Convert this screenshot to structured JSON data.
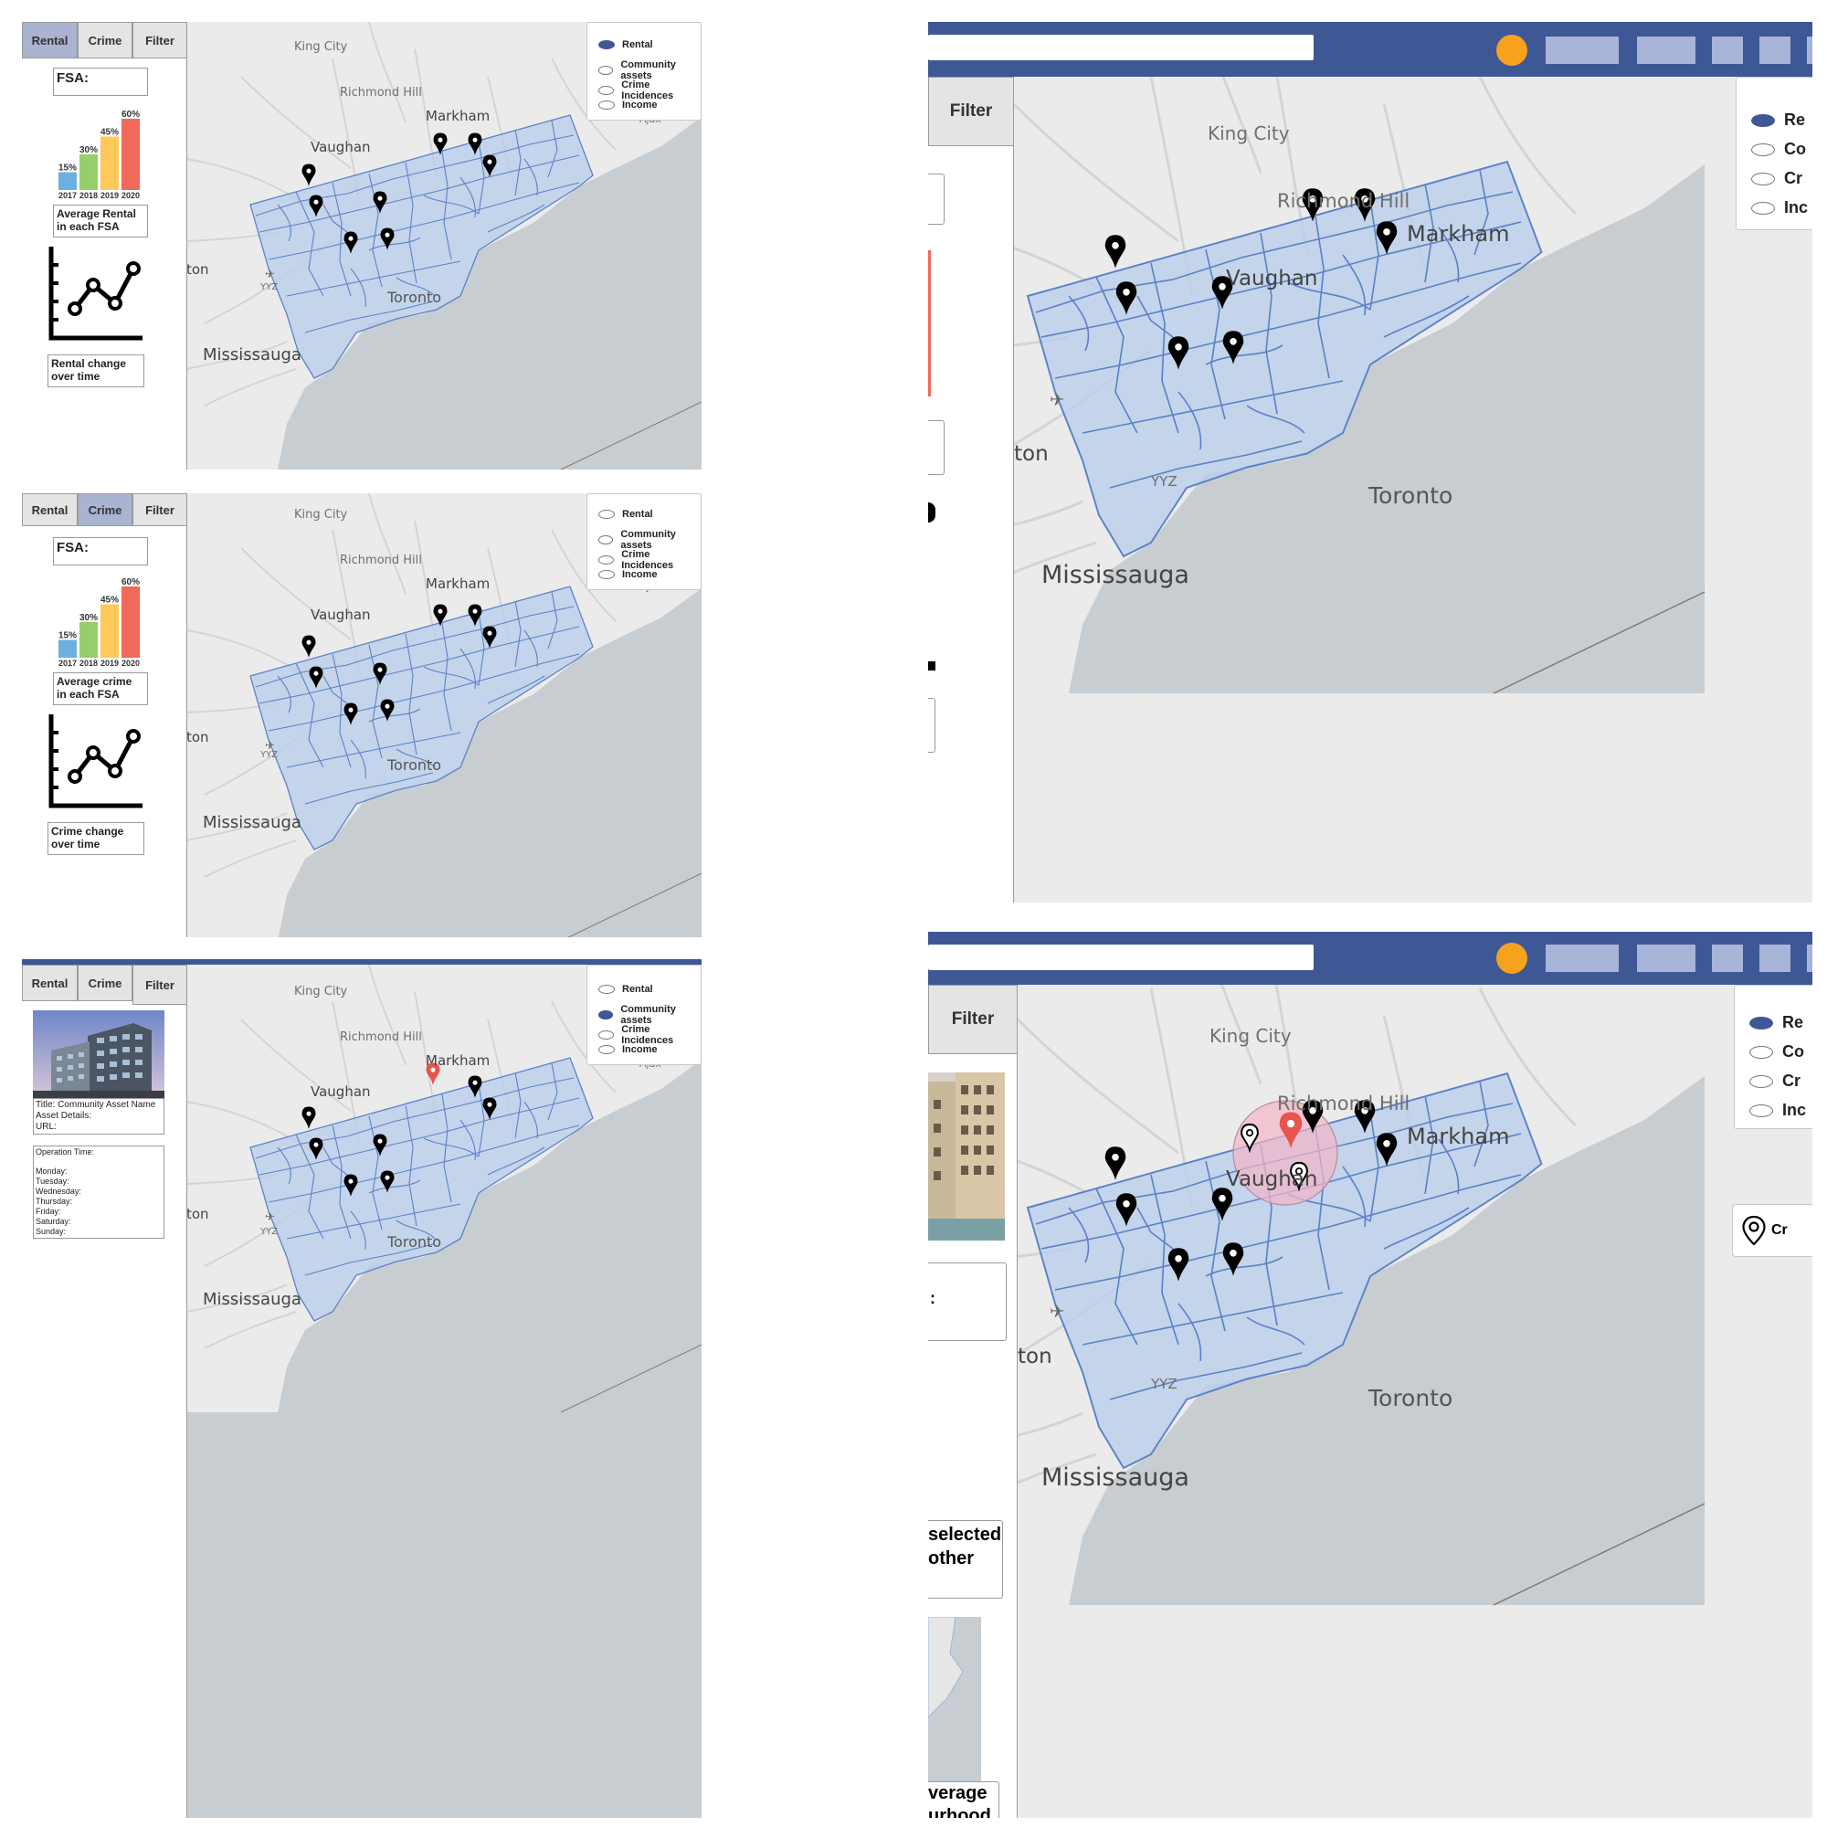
{
  "tabs": {
    "rental": "Rental",
    "crime": "Crime",
    "filter": "Filter"
  },
  "legend": {
    "rental": "Rental",
    "community": "Community assets",
    "crime": "Crime Incidences",
    "income": "Income"
  },
  "big_legend_clip": [
    "Re",
    "Co",
    "Cr",
    "Inc"
  ],
  "big_legend_clip2": [
    "Re",
    "Co",
    "Cr",
    "Inc"
  ],
  "places": {
    "king_city": "King City",
    "richmond_hill": "Richmond Hill",
    "markham": "Markham",
    "vaughan": "Vaughan",
    "ton": "ton",
    "yyz": "YYZ",
    "toronto": "Toronto",
    "mississauga": "Mississauga",
    "ajax": "Ajax"
  },
  "fsa_label": "FSA:",
  "bar_chart": {
    "categories": [
      "2017",
      "2018",
      "2019",
      "2020"
    ],
    "values_pct": [
      15,
      30,
      45,
      60
    ],
    "labels": [
      "15%",
      "30%",
      "45%",
      "60%"
    ],
    "colors": [
      "#6cb0e0",
      "#96cf6a",
      "#ffc85a",
      "#f0695a"
    ]
  },
  "rental_panel": {
    "caption_avg": "Average Rental in each FSA",
    "caption_change": "Rental change over time"
  },
  "crime_panel": {
    "caption_avg": "Average crime in each FSA",
    "caption_change": "Crime change over time"
  },
  "asset_panel": {
    "details": [
      "Title: Community Asset Name",
      "Asset Details:",
      "URL:"
    ],
    "hours_title": "Operation Time:",
    "days": [
      "Monday:",
      "Tuesday:",
      "Wednesday:",
      "Thursday:",
      "Friday:",
      "Saturday:",
      "Sunday:"
    ]
  },
  "right_bottom": {
    "clip_selected": "selected",
    "clip_other": "other",
    "clip_average": "verage",
    "clip_hood": "urhood",
    "clip_colon": ":",
    "clip_cr": "Cr"
  },
  "colors": {
    "accent": "#3e5795",
    "pin": "#000000",
    "pin_selected": "#e8544e",
    "region_fill": "#b9cdea",
    "region_stroke": "#5b82c8",
    "water": "#c8cdd1",
    "orange_dot": "#f6a21c"
  }
}
